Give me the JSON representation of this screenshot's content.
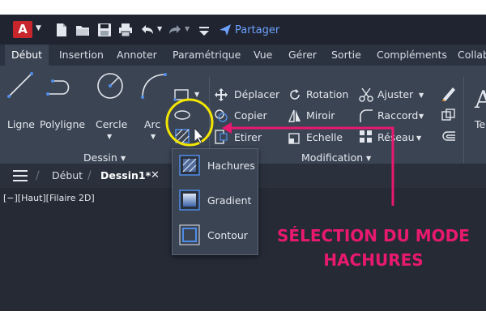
{
  "app": {
    "logo_letter": "A",
    "share_label": "Partager"
  },
  "ribbon_tabs": [
    "Début",
    "Insertion",
    "Annoter",
    "Paramétrique",
    "Vue",
    "Gérer",
    "Sortie",
    "Compléments",
    "Collab"
  ],
  "dessin_panel": {
    "title": "Dessin",
    "tools": [
      "Ligne",
      "Polyligne",
      "Cercle",
      "Arc"
    ]
  },
  "modification_panel": {
    "title": "Modification",
    "tools": [
      "Déplacer",
      "Rotation",
      "Ajuster",
      "Copier",
      "Miroir",
      "Raccord",
      "Etirer",
      "Echelle",
      "Réseau"
    ]
  },
  "annotation_partial_label": "Te",
  "doc_tabs": {
    "home": "Début",
    "active": "Dessin1*"
  },
  "viewport_label": "[−][Haut][Filaire 2D]",
  "hatch_dropdown": {
    "items": [
      "Hachures",
      "Gradient",
      "Contour"
    ]
  },
  "callout": {
    "line1": "SÉLECTION DU MODE",
    "line2": "HACHURES"
  },
  "colors": {
    "accent_pink": "#e8196f",
    "highlight_ring": "#f2e600",
    "share_blue": "#6ea2ff",
    "logo_red": "#c8252c"
  },
  "icons": [
    "autocad-logo",
    "new-file-icon",
    "open-folder-icon",
    "save-icon",
    "print-icon",
    "undo-icon",
    "redo-icon",
    "share-icon",
    "line-icon",
    "polyline-icon",
    "circle-icon",
    "arc-icon",
    "move-icon",
    "rotate-icon",
    "trim-icon",
    "copy-icon",
    "mirror-icon",
    "fillet-icon",
    "stretch-icon",
    "scale-icon",
    "array-icon",
    "hatch-icon",
    "gradient-icon",
    "boundary-icon",
    "menu-icon",
    "close-icon"
  ]
}
